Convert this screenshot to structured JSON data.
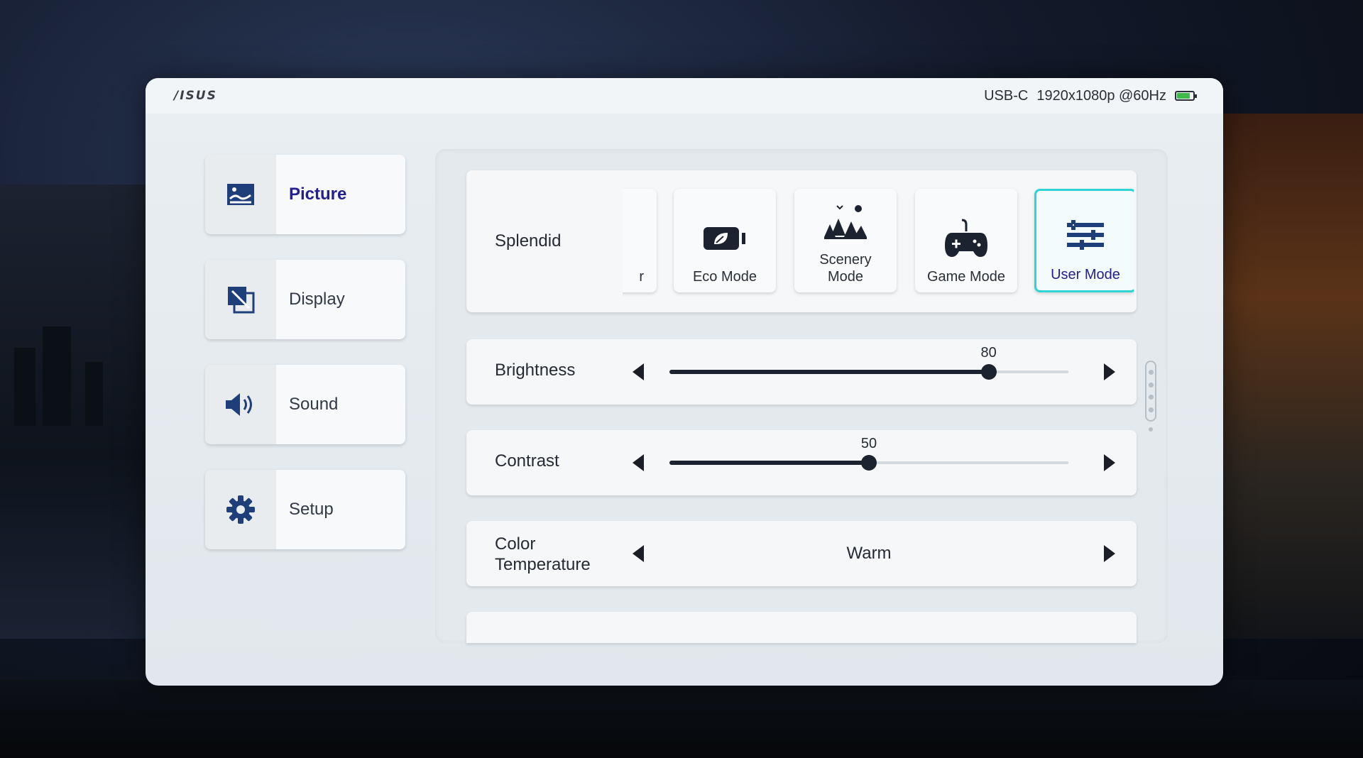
{
  "topbar": {
    "logo": "/ISUS",
    "input": "USB-C",
    "resolution": "1920x1080p @60Hz",
    "battery_level": 0.8,
    "battery_color": "#3fb94a"
  },
  "nav": [
    {
      "label": "Picture",
      "icon": "picture-icon",
      "active": true
    },
    {
      "label": "Display",
      "icon": "display-icon",
      "active": false
    },
    {
      "label": "Sound",
      "icon": "speaker-icon",
      "active": false
    },
    {
      "label": "Setup",
      "icon": "gear-icon",
      "active": false
    }
  ],
  "splendid": {
    "label": "Splendid",
    "modes": [
      {
        "label": "r",
        "icon": "partial-mode-icon",
        "clipped": true
      },
      {
        "label": "Eco Mode",
        "icon": "eco-leaf-icon"
      },
      {
        "label": "Scenery Mode",
        "icon": "scenery-trees-icon"
      },
      {
        "label": "Game Mode",
        "icon": "gamepad-icon"
      },
      {
        "label": "User Mode",
        "icon": "user-sliders-icon",
        "selected": true
      }
    ],
    "selected_color": "#2fd4d4"
  },
  "brightness": {
    "label": "Brightness",
    "value": "80",
    "level": 80,
    "max": 100
  },
  "contrast": {
    "label": "Contrast",
    "value": "50",
    "level": 50,
    "max": 100
  },
  "color_temperature": {
    "label": "Color Temperature",
    "value": "Warm"
  },
  "colors": {
    "accent_text": "#23208f",
    "icon_blue": "#1f3f7a"
  }
}
